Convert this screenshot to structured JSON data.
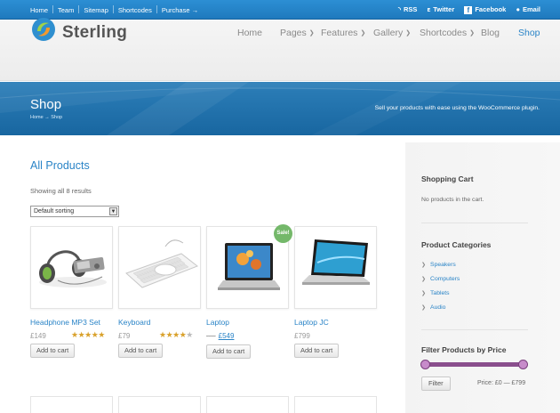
{
  "topbar": {
    "links": [
      "Home",
      "Team",
      "Sitemap",
      "Shortcodes",
      "Purchase →"
    ],
    "social": {
      "rss": "RSS",
      "twitter": "Twitter",
      "facebook": "Facebook",
      "email": "Email"
    }
  },
  "header": {
    "logo_text": "Sterling",
    "nav": [
      {
        "label": "Home",
        "dropdown": false
      },
      {
        "label": "Pages",
        "dropdown": true
      },
      {
        "label": "Features",
        "dropdown": true
      },
      {
        "label": "Gallery",
        "dropdown": true
      },
      {
        "label": "Shortcodes",
        "dropdown": true
      },
      {
        "label": "Blog",
        "dropdown": false
      },
      {
        "label": "Shop",
        "dropdown": false,
        "active": true
      }
    ]
  },
  "banner": {
    "title": "Shop",
    "breadcrumb": "Home → Shop",
    "tagline": "Sell your products with ease using the WooCommerce plugin."
  },
  "main": {
    "heading": "All Products",
    "result_count": "Showing all 8 results",
    "sort": {
      "selected": "Default sorting"
    },
    "products": [
      {
        "name": "Headphone MP3 Set",
        "price": "£149",
        "rating": 5,
        "button": "Add to cart"
      },
      {
        "name": "Keyboard",
        "price": "£79",
        "rating": 4,
        "button": "Add to cart"
      },
      {
        "name": "Laptop",
        "old_price": "----",
        "price": "£549",
        "sale_badge": "Sale!",
        "button": "Add to cart"
      },
      {
        "name": "Laptop JC",
        "price": "£799",
        "button": "Add to cart"
      }
    ]
  },
  "sidebar": {
    "cart": {
      "title": "Shopping Cart",
      "empty_text": "No products in the cart."
    },
    "categories": {
      "title": "Product Categories",
      "items": [
        "Speakers",
        "Computers",
        "Tablets",
        "Audio"
      ]
    },
    "price_filter": {
      "title": "Filter Products by Price",
      "button": "Filter",
      "range": "Price: £0 — £799"
    }
  },
  "colors": {
    "accent": "#2a84c7",
    "topbar": "#1f79bd",
    "banner": "#1e6ea8",
    "slider": "#8a4f8d",
    "sale": "#74b86a",
    "stars": "#d9a12b"
  }
}
